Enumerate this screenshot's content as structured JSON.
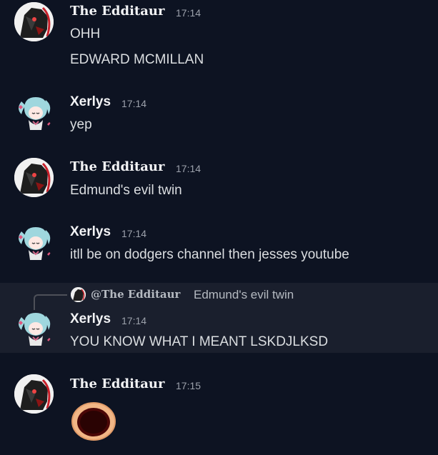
{
  "messages": [
    {
      "author": "The Edditaur",
      "time": "17:14",
      "lines": [
        "OHH",
        "EDWARD MCMILLAN"
      ]
    },
    {
      "author": "Xerlys",
      "time": "17:14",
      "lines": [
        "yep"
      ]
    },
    {
      "author": "The Edditaur",
      "time": "17:14",
      "lines": [
        "Edmund's evil twin"
      ]
    },
    {
      "author": "Xerlys",
      "time": "17:14",
      "lines": [
        "itll be on dodgers channel then jesses youtube"
      ]
    },
    {
      "reply": {
        "author": "@The Edditaur",
        "text": "Edmund's evil twin"
      },
      "author": "Xerlys",
      "time": "17:14",
      "lines": [
        "YOU KNOW WHAT I MEANT LSKDJLKSD"
      ]
    },
    {
      "author": "The Edditaur",
      "time": "17:15",
      "lines": [],
      "emoji": "shocked-face-emoji"
    }
  ],
  "colors": {
    "background": "#0d1322",
    "highlight": "#1a1f2d",
    "author": "#f2f3f5",
    "text": "#dbdee1",
    "timestamp": "#9ca1ab"
  }
}
